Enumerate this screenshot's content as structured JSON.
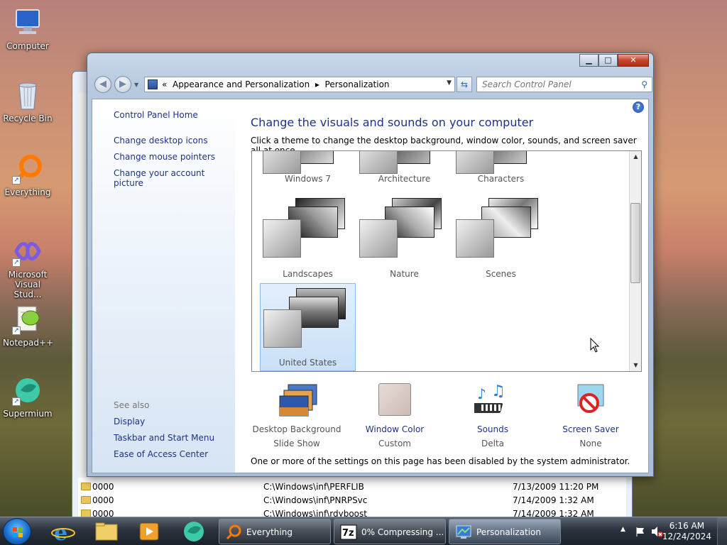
{
  "desktop": {
    "icons": [
      {
        "label": "Computer"
      },
      {
        "label": "Recycle Bin"
      },
      {
        "label": "Everything"
      },
      {
        "label": "Microsoft Visual Stud..."
      },
      {
        "label": "Notepad++"
      },
      {
        "label": "Supermium"
      }
    ]
  },
  "bg_window": {
    "rows": [
      {
        "name": "0000",
        "path": "C:\\Windows\\inf\\PERFLIB",
        "date": "7/13/2009 11:20 PM"
      },
      {
        "name": "0000",
        "path": "C:\\Windows\\inf\\PNRPSvc",
        "date": "7/14/2009 1:32 AM"
      },
      {
        "name": "0000",
        "path": "C:\\Windows\\inf\\rdyboost",
        "date": "7/14/2009 1:32 AM"
      }
    ]
  },
  "window": {
    "breadcrumb": {
      "prefix": "«",
      "part1": "Appearance and Personalization",
      "sep": "▸",
      "part2": "Personalization"
    },
    "search_placeholder": "Search Control Panel",
    "left": {
      "home": "Control Panel Home",
      "links": [
        "Change desktop icons",
        "Change mouse pointers",
        "Change your account picture"
      ],
      "see_also": "See also",
      "see_links": [
        "Display",
        "Taskbar and Start Menu",
        "Ease of Access Center"
      ]
    },
    "heading": "Change the visuals and sounds on your computer",
    "subheading": "Click a theme to change the desktop background, window color, sounds, and screen saver all at once.",
    "themes": [
      "Windows 7",
      "Architecture",
      "Characters",
      "Landscapes",
      "Nature",
      "Scenes",
      "United States"
    ],
    "bottom": [
      {
        "label": "Desktop Background",
        "value": "Slide Show"
      },
      {
        "label": "Window Color",
        "value": "Custom"
      },
      {
        "label": "Sounds",
        "value": "Delta"
      },
      {
        "label": "Screen Saver",
        "value": "None"
      }
    ],
    "note": "One or more of the settings on this page has been disabled by the system administrator."
  },
  "taskbar": {
    "buttons": [
      {
        "label": "Everything"
      },
      {
        "label": "0% Compressing ..."
      },
      {
        "label": "Personalization"
      }
    ],
    "time": "6:16 AM",
    "date": "12/24/2024"
  }
}
